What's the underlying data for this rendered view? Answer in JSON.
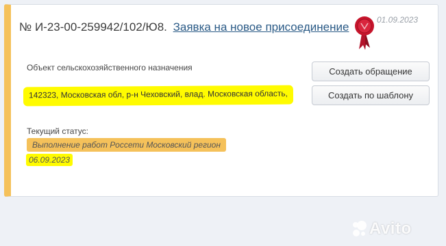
{
  "request": {
    "number": "№ И-23-00-259942/102/Ю8.",
    "title_link": "Заявка на новое присоединение",
    "date": "01.09.2023"
  },
  "object": {
    "type": "Объект сельскохозяйственного назначения",
    "address": "142323, Московская обл, р-н Чеховский, влад. Московская область,"
  },
  "actions": {
    "create_request": "Создать обращение",
    "create_from_template": "Создать по шаблону"
  },
  "status": {
    "label": "Текущий статус:",
    "value": "Выполнение работ Россети Московский регион",
    "date": "06.09.2023"
  },
  "watermark": {
    "text": "Avito"
  },
  "colors": {
    "accent": "#f5c15a",
    "highlight": "#fffb00",
    "link": "#2a5a86",
    "seal": "#c6142b"
  }
}
